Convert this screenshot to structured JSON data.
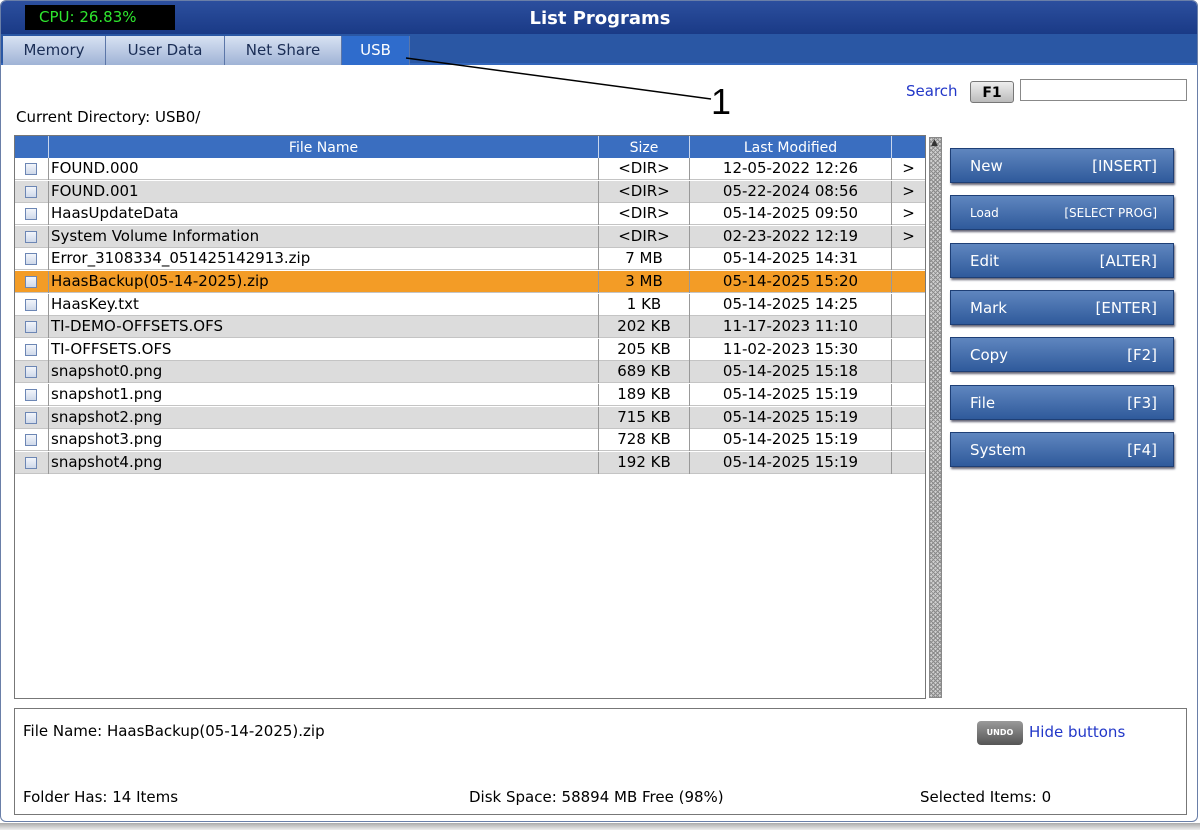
{
  "header": {
    "cpu": "CPU: 26.83%",
    "title": "List Programs"
  },
  "tabs": [
    "Memory",
    "User Data",
    "Net Share",
    "USB"
  ],
  "callout": "1",
  "search": {
    "label": "Search",
    "key": "F1",
    "value": ""
  },
  "current_directory": "Current Directory: USB0/",
  "table": {
    "columns": [
      "File Name",
      "Size",
      "Last Modified"
    ],
    "rows": [
      {
        "name": "FOUND.000",
        "size": "<DIR>",
        "modified": "12-05-2022 12:26",
        "arrow": ">"
      },
      {
        "name": "FOUND.001",
        "size": "<DIR>",
        "modified": "05-22-2024 08:56",
        "arrow": ">"
      },
      {
        "name": "HaasUpdateData",
        "size": "<DIR>",
        "modified": "05-14-2025 09:50",
        "arrow": ">"
      },
      {
        "name": "System Volume Information",
        "size": "<DIR>",
        "modified": "02-23-2022 12:19",
        "arrow": ">"
      },
      {
        "name": "Error_3108334_051425142913.zip",
        "size": "7 MB",
        "modified": "05-14-2025 14:31",
        "arrow": ""
      },
      {
        "name": "HaasBackup(05-14-2025).zip",
        "size": "3 MB",
        "modified": "05-14-2025 15:20",
        "arrow": "",
        "selected": true
      },
      {
        "name": "HaasKey.txt",
        "size": "1 KB",
        "modified": "05-14-2025 14:25",
        "arrow": ""
      },
      {
        "name": "TI-DEMO-OFFSETS.OFS",
        "size": "202 KB",
        "modified": "11-17-2023 11:10",
        "arrow": ""
      },
      {
        "name": "TI-OFFSETS.OFS",
        "size": "205 KB",
        "modified": "11-02-2023 15:30",
        "arrow": ""
      },
      {
        "name": "snapshot0.png",
        "size": "689 KB",
        "modified": "05-14-2025 15:18",
        "arrow": ""
      },
      {
        "name": "snapshot1.png",
        "size": "189 KB",
        "modified": "05-14-2025 15:19",
        "arrow": ""
      },
      {
        "name": "snapshot2.png",
        "size": "715 KB",
        "modified": "05-14-2025 15:19",
        "arrow": ""
      },
      {
        "name": "snapshot3.png",
        "size": "728 KB",
        "modified": "05-14-2025 15:19",
        "arrow": ""
      },
      {
        "name": "snapshot4.png",
        "size": "192 KB",
        "modified": "05-14-2025 15:19",
        "arrow": ""
      }
    ]
  },
  "side_buttons": [
    {
      "label": "New",
      "key": "[INSERT]"
    },
    {
      "label": "Load",
      "key": "[SELECT PROG]",
      "small": true
    },
    {
      "label": "Edit",
      "key": "[ALTER]"
    },
    {
      "label": "Mark",
      "key": "[ENTER]"
    },
    {
      "label": "Copy",
      "key": "[F2]"
    },
    {
      "label": "File",
      "key": "[F3]"
    },
    {
      "label": "System",
      "key": "[F4]"
    }
  ],
  "footer": {
    "file_name": "File Name: HaasBackup(05-14-2025).zip",
    "undo_key": "UNDO",
    "hide_buttons": "Hide buttons",
    "folder_has": "Folder Has: 14 Items",
    "disk_space": "Disk Space: 58894 MB Free (98%)",
    "selected_items": "Selected Items: 0"
  }
}
